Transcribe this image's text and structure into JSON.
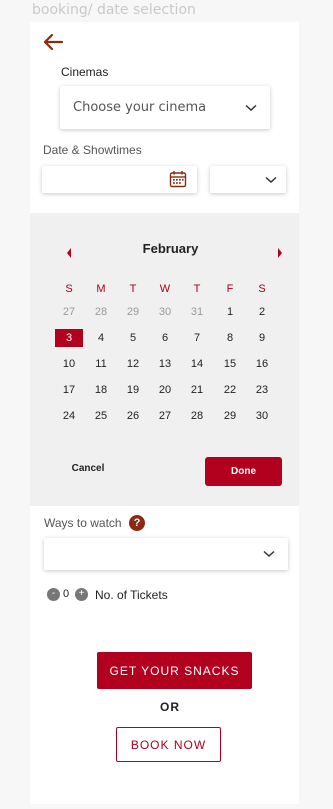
{
  "page_caption": "booking/ date selection",
  "header": {
    "back_icon": "arrow-left-icon"
  },
  "cinemas": {
    "label": "Cinemas",
    "placeholder": "Choose your cinema"
  },
  "date_showtimes": {
    "label": "Date & Showtimes",
    "date_value": "",
    "time_value": ""
  },
  "calendar": {
    "month": "February",
    "weekdays": [
      "S",
      "M",
      "T",
      "W",
      "T",
      "F",
      "S"
    ],
    "weeks": [
      [
        {
          "d": "27",
          "muted": true
        },
        {
          "d": "28",
          "muted": true
        },
        {
          "d": "29",
          "muted": true
        },
        {
          "d": "30",
          "muted": true
        },
        {
          "d": "31",
          "muted": true
        },
        {
          "d": "1"
        },
        {
          "d": "2"
        }
      ],
      [
        {
          "d": "3",
          "selected": true
        },
        {
          "d": "4"
        },
        {
          "d": "5"
        },
        {
          "d": "6"
        },
        {
          "d": "7"
        },
        {
          "d": "8"
        },
        {
          "d": "9"
        }
      ],
      [
        {
          "d": "10"
        },
        {
          "d": "11"
        },
        {
          "d": "12"
        },
        {
          "d": "13"
        },
        {
          "d": "14"
        },
        {
          "d": "15"
        },
        {
          "d": "16"
        }
      ],
      [
        {
          "d": "17"
        },
        {
          "d": "18"
        },
        {
          "d": "19"
        },
        {
          "d": "20"
        },
        {
          "d": "21"
        },
        {
          "d": "22"
        },
        {
          "d": "23"
        }
      ],
      [
        {
          "d": "24"
        },
        {
          "d": "25"
        },
        {
          "d": "26"
        },
        {
          "d": "27"
        },
        {
          "d": "28"
        },
        {
          "d": "29"
        },
        {
          "d": "30"
        }
      ]
    ],
    "cancel_label": "Cancel",
    "done_label": "Done"
  },
  "ways_to_watch": {
    "label": "Ways to watch",
    "help": "?",
    "value": ""
  },
  "tickets": {
    "minus": "-",
    "count": "0",
    "plus": "+",
    "label": "No. of Tickets"
  },
  "actions": {
    "snacks_label": "GET YOUR SNACKS",
    "or_label": "OR",
    "book_label": "BOOK NOW"
  },
  "colors": {
    "accent": "#b2001f",
    "back_arrow": "#8a2a10",
    "calendar_bg": "#f0f0f0"
  }
}
